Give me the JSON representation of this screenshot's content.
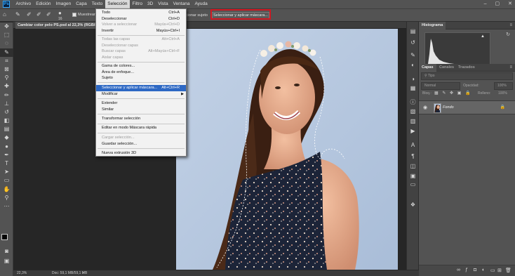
{
  "menubar": {
    "logo": "Ps",
    "items": [
      "Archivo",
      "Edición",
      "Imagen",
      "Capa",
      "Texto",
      "Selección",
      "Filtro",
      "3D",
      "Vista",
      "Ventana",
      "Ayuda"
    ],
    "active_item": "Selección",
    "window_controls": [
      "–",
      "▢",
      "✕"
    ]
  },
  "options_bar": {
    "brush_size": "16",
    "sample_all_layers_label": "Muestrear todas las capas",
    "select_subject_label": "Seleccionar sujeto",
    "select_and_mask_label": "Seleccionar y aplicar máscara..."
  },
  "document": {
    "tab_title": "Cambiar color pelo PS.psd al 22,3% (RGB/8",
    "zoom": "22,3%",
    "doc_info": "Doc: 59,1 MB/59,1 MB",
    "status_arrow": ">"
  },
  "dropdown_menu": {
    "items": [
      {
        "label": "Todo",
        "shortcut": "Ctrl+A",
        "disabled": false
      },
      {
        "label": "Deseleccionar",
        "shortcut": "Ctrl+D",
        "disabled": false
      },
      {
        "label": "Volver a seleccionar",
        "shortcut": "Mayús+Ctrl+D",
        "disabled": true
      },
      {
        "label": "Invertir",
        "shortcut": "Mayús+Ctrl+I",
        "disabled": false
      },
      {
        "label": "Todas las capas",
        "shortcut": "Alt+Ctrl+A",
        "disabled": true
      },
      {
        "label": "Deseleccionar capas",
        "shortcut": "",
        "disabled": true
      },
      {
        "label": "Buscar capas",
        "shortcut": "Alt+Mayús+Ctrl+F",
        "disabled": true
      },
      {
        "label": "Aislar capas",
        "shortcut": "",
        "disabled": true
      },
      {
        "label": "Gama de colores...",
        "shortcut": "",
        "disabled": false
      },
      {
        "label": "Área de enfoque...",
        "shortcut": "",
        "disabled": false
      },
      {
        "label": "Sujeto",
        "shortcut": "",
        "disabled": false
      },
      {
        "label": "Seleccionar y aplicar máscara...",
        "shortcut": "Alt+Ctrl+R",
        "disabled": false,
        "highlighted": true
      },
      {
        "label": "Modificar",
        "shortcut": "",
        "disabled": false,
        "submenu": true
      },
      {
        "label": "Extender",
        "shortcut": "",
        "disabled": false
      },
      {
        "label": "Similar",
        "shortcut": "",
        "disabled": false
      },
      {
        "label": "Transformar selección",
        "shortcut": "",
        "disabled": false
      },
      {
        "label": "Editar en modo Máscara rápida",
        "shortcut": "",
        "disabled": false
      },
      {
        "label": "Cargar selección...",
        "shortcut": "",
        "disabled": true
      },
      {
        "label": "Guardar selección...",
        "shortcut": "",
        "disabled": false
      },
      {
        "label": "Nueva extrusión 3D",
        "shortcut": "",
        "disabled": false
      }
    ]
  },
  "histogram_panel": {
    "tab": "Histograma",
    "warning_icon": "▲"
  },
  "layers_panel": {
    "tabs": [
      "Capas",
      "Canales",
      "Trazados"
    ],
    "kind_filter": "Tipo",
    "blend_mode": "Normal",
    "opacity_label": "Opacidad:",
    "opacity_value": "100%",
    "lock_label": "Bloq.:",
    "fill_label": "Relleno:",
    "fill_value": "100%",
    "layer_name": "Fondo"
  },
  "colors": {
    "selection_highlight": "#2d68c4",
    "annotation_red": "#d01822",
    "photo_background": "#b5c6dd"
  }
}
